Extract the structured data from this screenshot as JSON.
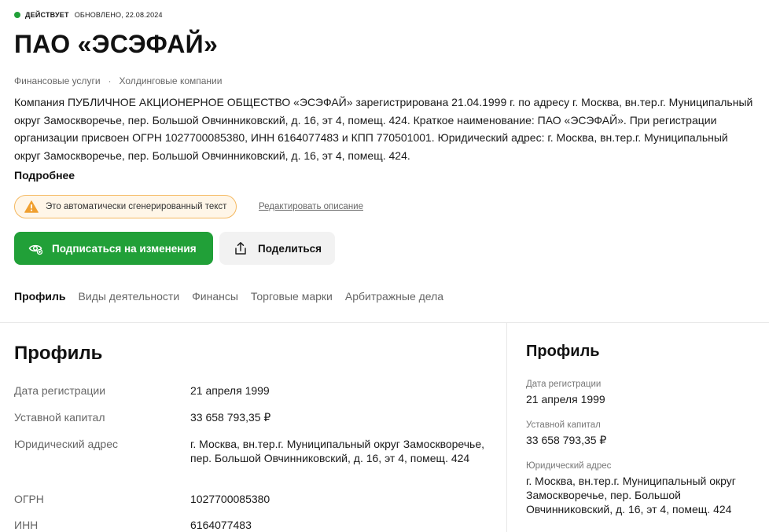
{
  "header": {
    "status": "ДЕЙСТВУЕТ",
    "updated": "ОБНОВЛЕНО, 22.08.2024",
    "status_color": "#21a038",
    "title": "ПАО «ЭСЭФАЙ»",
    "categories": [
      "Финансовые услуги",
      "Холдинговые компании"
    ],
    "category_separator": "·"
  },
  "description": {
    "text": "Компания ПУБЛИЧНОЕ АКЦИОНЕРНОЕ ОБЩЕСТВО «ЭСЭФАЙ» зарегистрирована 21.04.1999 г. по адресу г. Москва, вн.тер.г. Муниципальный округ Замоскворечье, пер. Большой Овчинниковский, д. 16, эт 4, помещ. 424. Краткое наименование: ПАО «ЭСЭФАЙ». При регистрации организации присвоен ОГРН 1027700085380, ИНН 6164077483 и КПП 770501001. Юридический адрес: г. Москва, вн.тер.г. Муниципальный округ Замоскворечье, пер. Большой Овчинниковский, д. 16, эт 4, помещ. 424.",
    "more_label": "Подробнее",
    "ai_notice": "Это автоматически сгенерированный текст",
    "edit_label": "Редактировать описание"
  },
  "actions": {
    "subscribe_label": "Подписаться на изменения",
    "share_label": "Поделиться",
    "accent_color": "#21a038"
  },
  "tabs": [
    {
      "label": "Профиль",
      "active": true
    },
    {
      "label": "Виды деятельности",
      "active": false
    },
    {
      "label": "Финансы",
      "active": false
    },
    {
      "label": "Торговые марки",
      "active": false
    },
    {
      "label": "Арбитражные дела",
      "active": false
    }
  ],
  "profile": {
    "title": "Профиль",
    "rows": [
      {
        "label": "Дата регистрации",
        "value": "21 апреля 1999"
      },
      {
        "label": "Уставной капитал",
        "value": "33 658 793,35 ₽"
      },
      {
        "label": "Юридический адрес",
        "value": "г. Москва, вн.тер.г. Муниципальный округ Замоскворечье, пер. Большой Овчинниковский, д. 16, эт 4, помещ. 424"
      },
      {
        "label": "ОГРН",
        "value": "1027700085380"
      },
      {
        "label": "ИНН",
        "value": "6164077483"
      }
    ]
  },
  "sidebar": {
    "title": "Профиль",
    "items": [
      {
        "label": "Дата регистрации",
        "value": "21 апреля 1999"
      },
      {
        "label": "Уставной капитал",
        "value": "33 658 793,35 ₽"
      },
      {
        "label": "Юридический адрес",
        "value": "г. Москва, вн.тер.г. Муниципальный округ Замоскворечье, пер. Большой Овчинниковский, д. 16, эт 4, помещ. 424"
      }
    ]
  }
}
